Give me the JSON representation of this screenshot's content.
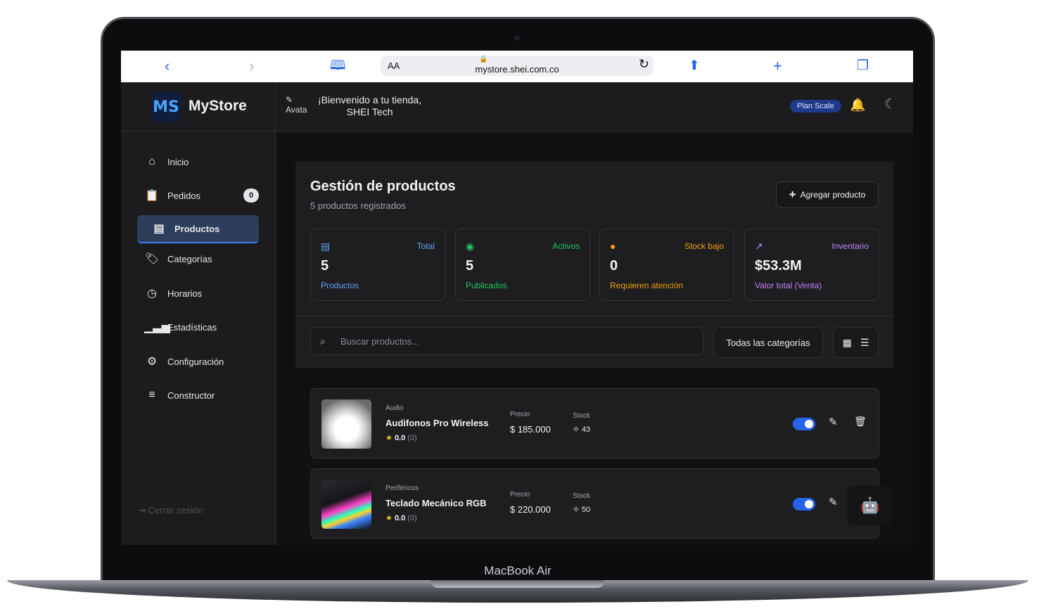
{
  "device": {
    "label": "MacBook Air"
  },
  "browser": {
    "aa_label": "AA",
    "url": "mystore.shei.com.co"
  },
  "header": {
    "brand_logo_text": "MS",
    "brand_name": "MyStore",
    "avatar_alt": "Avata",
    "welcome_line1": "¡Bienvenido a tu tienda,",
    "welcome_line2": "SHEI Tech",
    "plan_badge": "Plan Scale"
  },
  "sidebar": {
    "items": [
      {
        "label": "Inicio",
        "icon": "home-icon"
      },
      {
        "label": "Pedidos",
        "icon": "clipboard-icon",
        "badge": "0"
      },
      {
        "label": "Productos",
        "icon": "box-icon",
        "active": true
      },
      {
        "label": "Categorías",
        "icon": "tags-icon"
      },
      {
        "label": "Horarios",
        "icon": "clock-icon"
      },
      {
        "label": "Estadísticas",
        "icon": "bar-chart-icon"
      },
      {
        "label": "Configuración",
        "icon": "gear-icon"
      },
      {
        "label": "Constructor",
        "icon": "layers-icon"
      }
    ],
    "logout_label": "Cerrar sesión"
  },
  "main": {
    "title": "Gestión de productos",
    "subtitle": "5 productos registrados",
    "add_button_label": "Agregar producto",
    "stats": [
      {
        "label": "Total",
        "value": "5",
        "desc": "Productos",
        "color": "#60a5fa",
        "icon": "box-icon"
      },
      {
        "label": "Activos",
        "value": "5",
        "desc": "Publicados",
        "color": "#22c55e",
        "icon": "eye-icon"
      },
      {
        "label": "Stock bajo",
        "value": "0",
        "desc": "Requieren atención",
        "color": "#f59e0b",
        "icon": "alert-icon"
      },
      {
        "label": "Inventario",
        "value": "$53.3M",
        "desc": "Valor total (Venta)",
        "color": "#c084fc",
        "icon": "chart-line-icon"
      }
    ],
    "search_placeholder": "Buscar productos...",
    "category_filter": "Todas las categorías",
    "products": [
      {
        "category": "Audio",
        "name": "Audifonos Pro Wireless",
        "rating": "0.0",
        "rating_count": "(0)",
        "price_label": "Precio",
        "price": "$ 185.000",
        "stock_label": "Stock",
        "stock": "43",
        "active": true
      },
      {
        "category": "Periféricos",
        "name": "Teclado Mecánico RGB",
        "rating": "0.0",
        "rating_count": "(0)",
        "price_label": "Precio",
        "price": "$ 220.000",
        "stock_label": "Stock",
        "stock": "50",
        "active": true
      }
    ]
  }
}
